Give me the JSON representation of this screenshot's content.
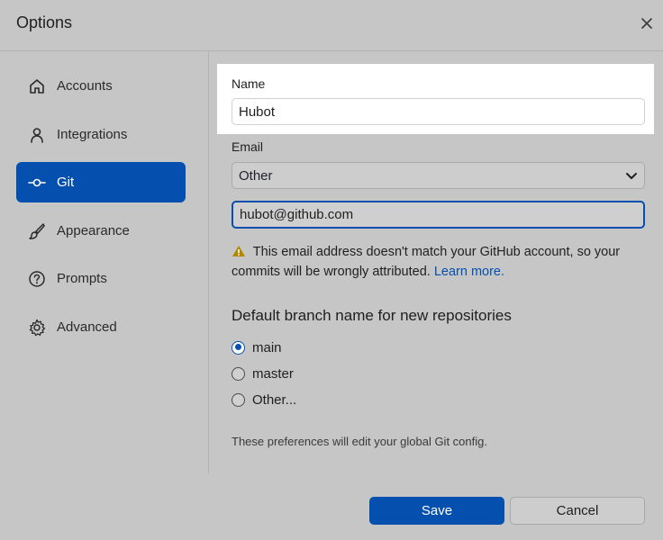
{
  "window": {
    "title": "Options"
  },
  "sidebar": {
    "items": [
      {
        "label": "Accounts",
        "icon": "home-icon",
        "selected": false
      },
      {
        "label": "Integrations",
        "icon": "person-icon",
        "selected": false
      },
      {
        "label": "Git",
        "icon": "git-commit-icon",
        "selected": true
      },
      {
        "label": "Appearance",
        "icon": "paintbrush-icon",
        "selected": false
      },
      {
        "label": "Prompts",
        "icon": "question-icon",
        "selected": false
      },
      {
        "label": "Advanced",
        "icon": "gear-icon",
        "selected": false
      }
    ]
  },
  "git": {
    "name_label": "Name",
    "name_value": "Hubot",
    "email_label": "Email",
    "email_select_value": "Other",
    "email_value": "hubot@github.com",
    "warning_text": "This email address doesn't match your GitHub account, so your commits will be wrongly attributed.",
    "warning_link": "Learn more.",
    "branch_heading": "Default branch name for new repositories",
    "branch_options": [
      {
        "label": "main",
        "checked": true
      },
      {
        "label": "master",
        "checked": false
      },
      {
        "label": "Other...",
        "checked": false
      }
    ],
    "footnote": "These preferences will edit your global Git config."
  },
  "footer": {
    "save_label": "Save",
    "cancel_label": "Cancel"
  },
  "colors": {
    "accent": "#0550ae",
    "background": "#c6c6c6",
    "warning": "#b08800"
  }
}
